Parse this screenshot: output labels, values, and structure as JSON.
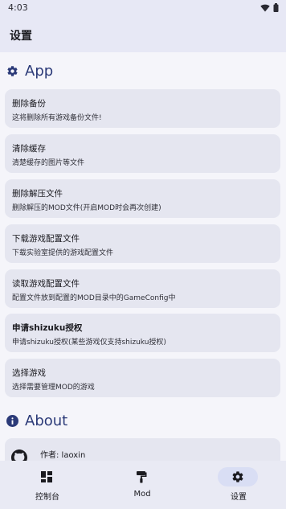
{
  "status_bar": {
    "time": "4:03",
    "wifi_icon": "wifi-icon",
    "battery_icon": "battery-icon"
  },
  "app_bar": {
    "title": "设置"
  },
  "sections": {
    "app": {
      "icon": "gear-icon",
      "title": "App"
    },
    "about": {
      "icon": "info-icon",
      "title": "About"
    }
  },
  "settings_items": [
    {
      "title": "删除备份",
      "subtitle": "这将删除所有游戏备份文件!"
    },
    {
      "title": "清除缓存",
      "subtitle": "清楚缓存的图片等文件"
    },
    {
      "title": "删除解压文件",
      "subtitle": "删除解压的MOD文件(开启MOD时会再次创建)"
    },
    {
      "title": "下载游戏配置文件",
      "subtitle": "下载实验室提供的游戏配置文件"
    },
    {
      "title": "读取游戏配置文件",
      "subtitle": "配置文件放到配置的MOD目录中的GameConfig中"
    },
    {
      "title": "申请shizuku授权",
      "subtitle": "申请shizuku授权(某些游戏仅支持shizuku授权)"
    },
    {
      "title": "选择游戏",
      "subtitle": "选择需要管理MOD的游戏"
    }
  ],
  "about": {
    "author": "作者: laoxin",
    "avatar_icon": "github-icon"
  },
  "bottom_nav": [
    {
      "label": "控制台",
      "icon": "dashboard-icon",
      "active": false
    },
    {
      "label": "Mod",
      "icon": "paint-roller-icon",
      "active": false
    },
    {
      "label": "设置",
      "icon": "gear-icon",
      "active": true
    }
  ],
  "colors": {
    "accent": "#2b3a78",
    "surface": "#e5e6f0",
    "app_bar": "#e7e8f5",
    "nav_active": "#d9def4"
  }
}
